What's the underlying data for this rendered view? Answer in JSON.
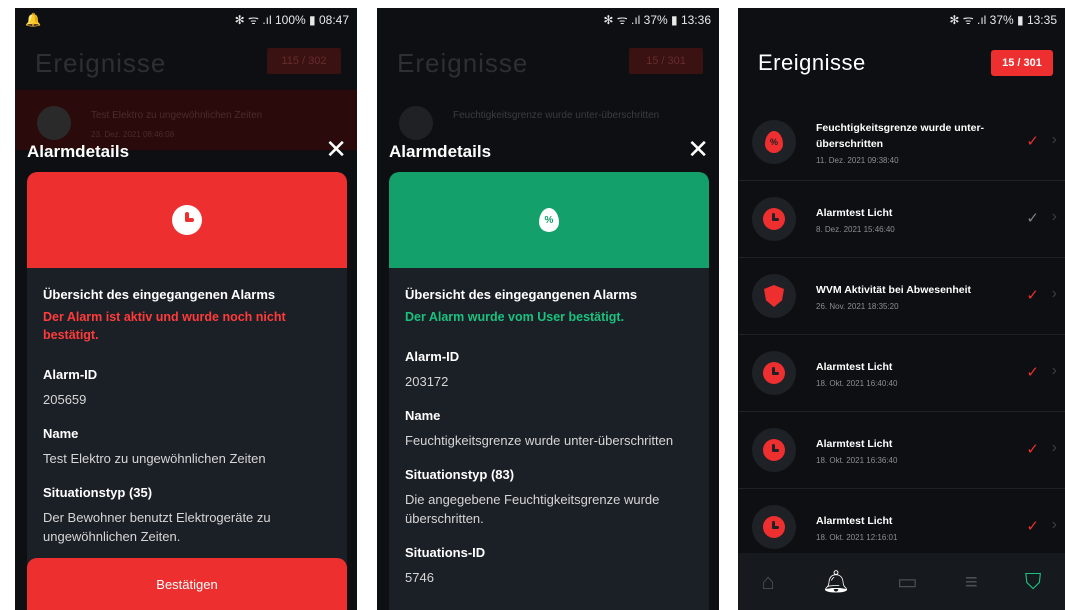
{
  "statusbar": {
    "p1": {
      "text": "✻ ᯤ .ıl 100% ▮ 08:47"
    },
    "p2": {
      "text": "✻ ᯤ .ıl 37% ▮ 13:36"
    },
    "p3": {
      "text": "✻ ᯤ .ıl 37% ▮ 13:35"
    }
  },
  "screen_title": "Ereignisse",
  "p1": {
    "bg_badge": "115 / 302",
    "bg_row_title": "Test Elektro zu ungewöhnlichen Zeiten",
    "bg_row_date": "23. Dez. 2021 08:46:08",
    "modal_title": "Alarmdetails",
    "overview": "Übersicht des eingegangenen Alarms",
    "status": "Der Alarm ist aktiv und wurde noch nicht bestätigt.",
    "fields": [
      {
        "label": "Alarm-ID",
        "value": "205659"
      },
      {
        "label": "Name",
        "value": "Test Elektro zu ungewöhnlichen Zeiten"
      },
      {
        "label": "Situationstyp (35)",
        "value": "Der Bewohner benutzt Elektrogeräte zu ungewöhnlichen Zeiten."
      }
    ],
    "confirm_label": "Bestätigen",
    "banner_color": "#ee2f2f"
  },
  "p2": {
    "bg_badge": "15 / 301",
    "bg_row_title": "Feuchtigkeitsgrenze wurde unter-überschritten",
    "modal_title": "Alarmdetails",
    "overview": "Übersicht des eingegangenen Alarms",
    "status": "Der Alarm wurde vom User bestätigt.",
    "fields": [
      {
        "label": "Alarm-ID",
        "value": "203172"
      },
      {
        "label": "Name",
        "value": "Feuchtigkeitsgrenze wurde unter-überschritten"
      },
      {
        "label": "Situationstyp (83)",
        "value": "Die angegebene Feuchtigkeitsgrenze wurde überschritten."
      },
      {
        "label": "Situations-ID",
        "value": "5746"
      }
    ],
    "banner_color": "#14a06a"
  },
  "p3": {
    "badge": "15 / 301",
    "events": [
      {
        "title": "Feuchtigkeitsgrenze wurde unter-überschritten",
        "date": "11. Dez. 2021 09:38:40",
        "icon": "humidity-icon",
        "check": "red"
      },
      {
        "title": "Alarmtest Licht",
        "date": "8. Dez. 2021 15:46:40",
        "icon": "clock-icon",
        "check": "grey"
      },
      {
        "title": "WVM Aktivität bei Abwesenheit",
        "date": "26. Nov. 2021 18:35:20",
        "icon": "shield-icon",
        "check": "red"
      },
      {
        "title": "Alarmtest Licht",
        "date": "18. Okt. 2021 16:40:40",
        "icon": "clock-icon",
        "check": "red"
      },
      {
        "title": "Alarmtest Licht",
        "date": "18. Okt. 2021 16:36:40",
        "icon": "clock-icon",
        "check": "red"
      },
      {
        "title": "Alarmtest Licht",
        "date": "18. Okt. 2021 12:16:01",
        "icon": "clock-icon",
        "check": "red"
      }
    ],
    "tabs": [
      "home-icon",
      "bell-icon",
      "camera-icon",
      "menu-icon",
      "shield-icon"
    ]
  },
  "colors": {
    "accent_red": "#ee2f2f",
    "accent_green": "#19c27e",
    "background": "#0d0f12"
  }
}
